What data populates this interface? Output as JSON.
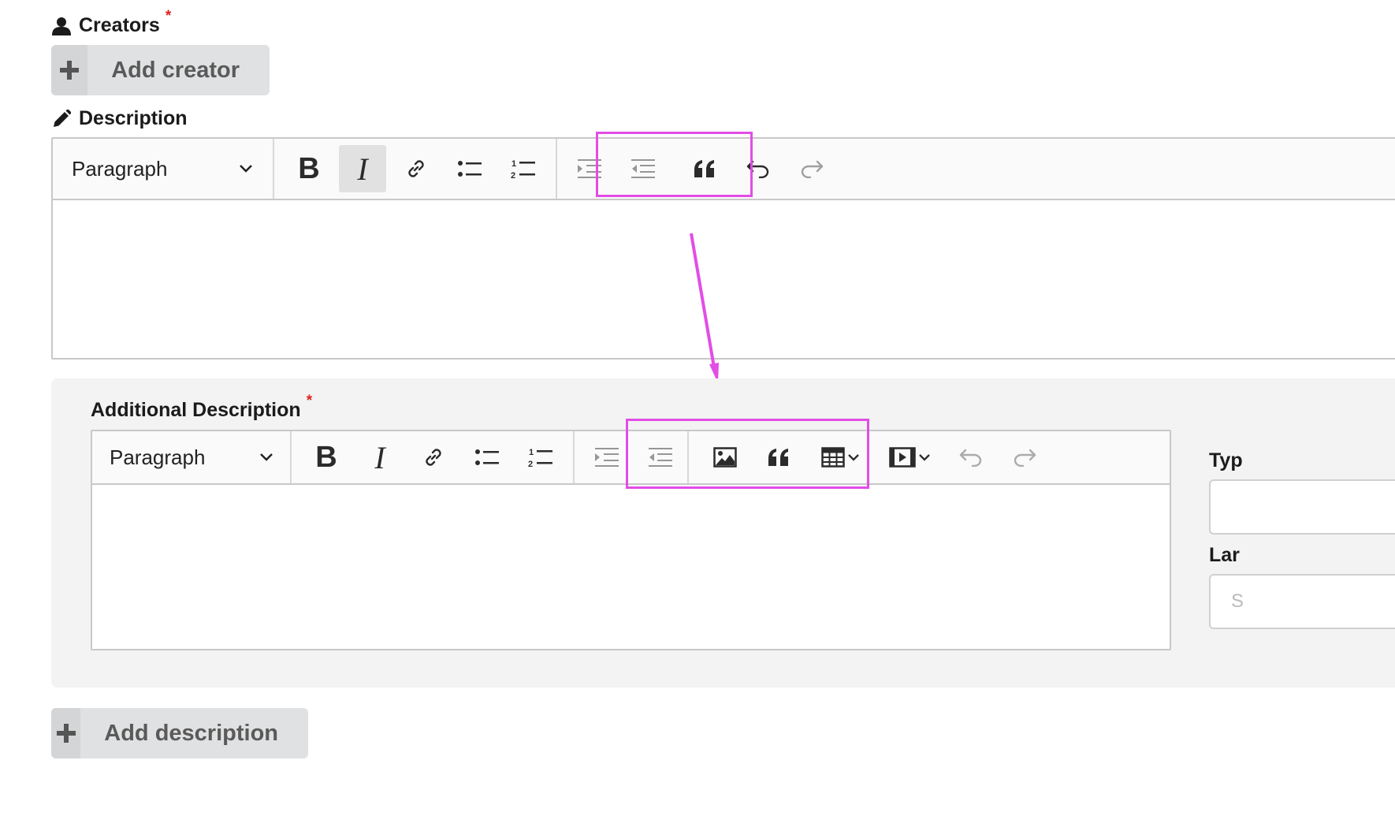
{
  "creators": {
    "label": "Creators",
    "required_mark": "*",
    "add_button": "Add creator"
  },
  "description": {
    "label": "Description",
    "toolbar": {
      "format_select": "Paragraph",
      "bold": "B",
      "italic": "I"
    }
  },
  "additional_description": {
    "label": "Additional Description",
    "required_mark": "*",
    "toolbar": {
      "format_select": "Paragraph",
      "bold": "B",
      "italic": "I"
    },
    "side_fields": [
      {
        "label": "Typ"
      },
      {
        "label": "Lar",
        "placeholder": "S"
      }
    ]
  },
  "add_description_button": "Add description",
  "annotation": {
    "color": "#e24de6"
  },
  "colors": {
    "required": "#dd2222",
    "button_bg": "#e0e1e2",
    "panel_bg": "#f3f3f3"
  }
}
